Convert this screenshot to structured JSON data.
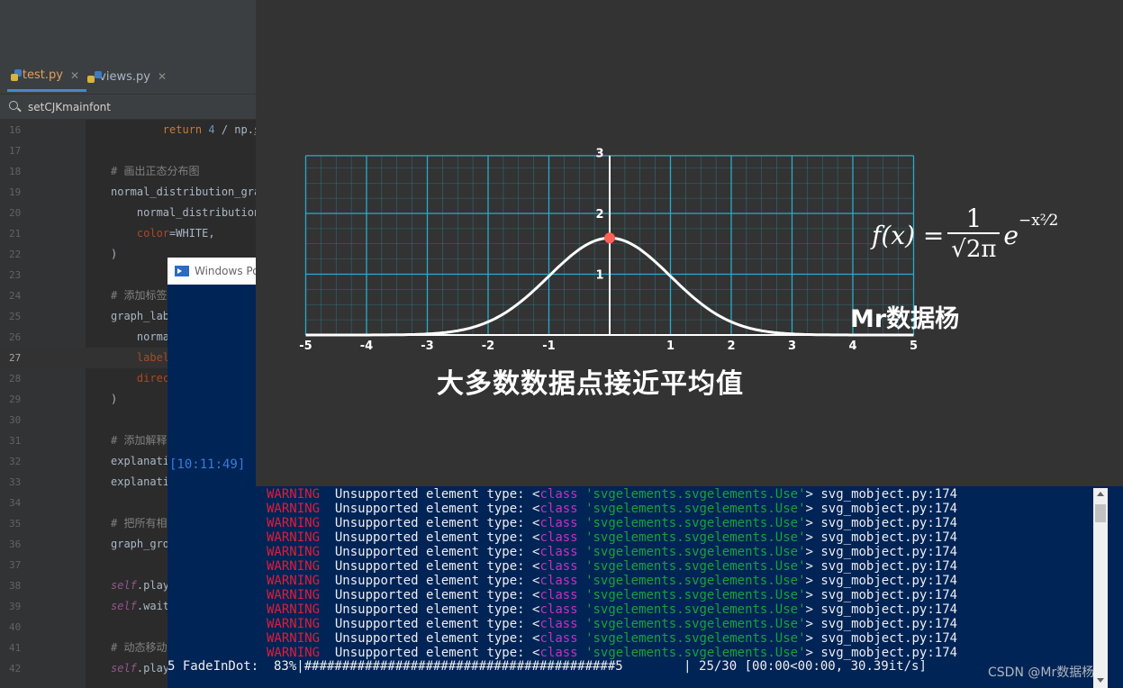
{
  "ide": {
    "tabs": [
      {
        "label": "test.py",
        "icon": "python-file-icon",
        "active": true
      },
      {
        "label": "views.py",
        "icon": "python-file-icon",
        "active": false
      }
    ],
    "search": {
      "value": "setCJKmainfont"
    },
    "code_lines": [
      {
        "num": "16",
        "segments": [
          [
            "        ",
            ""
          ],
          [
            "return ",
            "kw"
          ],
          [
            "4",
            "num"
          ],
          [
            " / np.",
            ""
          ],
          [
            "sqrt",
            "fn-u"
          ],
          [
            "(",
            ""
          ]
        ]
      },
      {
        "num": "17",
        "segments": []
      },
      {
        "num": "18",
        "segments": [
          [
            "# 画出正态分布图",
            "cm"
          ]
        ]
      },
      {
        "num": "19",
        "segments": [
          [
            "normal_distribution_gra",
            ""
          ]
        ]
      },
      {
        "num": "20",
        "segments": [
          [
            "    normal_distribution",
            ""
          ]
        ]
      },
      {
        "num": "21",
        "segments": [
          [
            "    ",
            ""
          ],
          [
            "color",
            "param"
          ],
          [
            "=WHITE,",
            ""
          ]
        ]
      },
      {
        "num": "22",
        "segments": [
          [
            ")",
            ""
          ]
        ]
      },
      {
        "num": "23",
        "segments": []
      },
      {
        "num": "24",
        "segments": [
          [
            "# 添加标签",
            "cm"
          ]
        ]
      },
      {
        "num": "25",
        "segments": [
          [
            "graph_lab",
            ""
          ]
        ]
      },
      {
        "num": "26",
        "segments": [
          [
            "    norma",
            ""
          ]
        ]
      },
      {
        "num": "27",
        "segments": [
          [
            "    ",
            ""
          ],
          [
            "label",
            "param"
          ]
        ],
        "current": true
      },
      {
        "num": "28",
        "segments": [
          [
            "    ",
            ""
          ],
          [
            "direc",
            "param"
          ]
        ]
      },
      {
        "num": "29",
        "segments": [
          [
            ")",
            ""
          ]
        ]
      },
      {
        "num": "30",
        "segments": []
      },
      {
        "num": "31",
        "segments": [
          [
            "# 添加解释",
            "cm"
          ]
        ]
      },
      {
        "num": "32",
        "segments": [
          [
            "explanati",
            ""
          ]
        ]
      },
      {
        "num": "33",
        "segments": [
          [
            "explanati",
            ""
          ]
        ]
      },
      {
        "num": "34",
        "segments": []
      },
      {
        "num": "35",
        "segments": [
          [
            "# 把所有相",
            "cm"
          ]
        ]
      },
      {
        "num": "36",
        "segments": [
          [
            "graph_gro",
            ""
          ]
        ]
      },
      {
        "num": "37",
        "segments": []
      },
      {
        "num": "38",
        "segments": [
          [
            "self",
            "self"
          ],
          [
            ".play",
            ""
          ]
        ]
      },
      {
        "num": "39",
        "segments": [
          [
            "self",
            "self"
          ],
          [
            ".wait",
            ""
          ]
        ]
      },
      {
        "num": "40",
        "segments": []
      },
      {
        "num": "41",
        "segments": [
          [
            "# 动态移动",
            "cm"
          ]
        ]
      },
      {
        "num": "42",
        "segments": [
          [
            "self",
            "self"
          ],
          [
            ".play",
            ""
          ]
        ]
      }
    ]
  },
  "powershell": {
    "title": "Windows Po",
    "timestamp": "[10:11:49]",
    "warning_line": {
      "level": "WARNING",
      "message": "Unsupported element type: ",
      "lt": "<",
      "cls": "class",
      "string": "'svgelements.svgelements.Use'",
      "rest": "> svg_mobject.py:174"
    },
    "warning_count": 12,
    "progress": "5 FadeInDot:  83%|#########################################5        | 25/30 [00:00<00:00, 30.39it/s]"
  },
  "manim": {
    "formula": {
      "fx": "f(x) =",
      "numerator": "1",
      "denominator": "√2π",
      "base": "e",
      "exponent": "−x²⁄2"
    },
    "watermark": "Mr数据杨",
    "caption": "大多数数据点接近平均值",
    "x_ticks": [
      "-5",
      "-4",
      "-3",
      "-2",
      "-1",
      "1",
      "2",
      "3",
      "4",
      "5"
    ],
    "y_ticks": [
      "1",
      "2",
      "3"
    ],
    "colors": {
      "grid": "#29abca",
      "curve": "#ffffff",
      "dot": "#fc6255",
      "background": "#333333"
    }
  },
  "chart_data": {
    "type": "line",
    "title": "",
    "xlabel": "",
    "ylabel": "",
    "xlim": [
      -5,
      5
    ],
    "ylim": [
      0,
      3
    ],
    "grid": true,
    "series": [
      {
        "values_x": [
          -5,
          -4,
          -3,
          -2,
          -1.5,
          -1,
          -0.5,
          0,
          0.5,
          1,
          1.5,
          2,
          3,
          4,
          5
        ],
        "values_y": [
          0.0,
          0.001,
          0.018,
          0.216,
          0.518,
          0.968,
          1.408,
          1.596,
          1.408,
          0.968,
          0.518,
          0.216,
          0.018,
          0.001,
          0.0
        ]
      }
    ],
    "highlight_point": {
      "x": 0,
      "y": 1.596
    }
  },
  "footer": {
    "csdn": "CSDN @Mr数据杨"
  }
}
